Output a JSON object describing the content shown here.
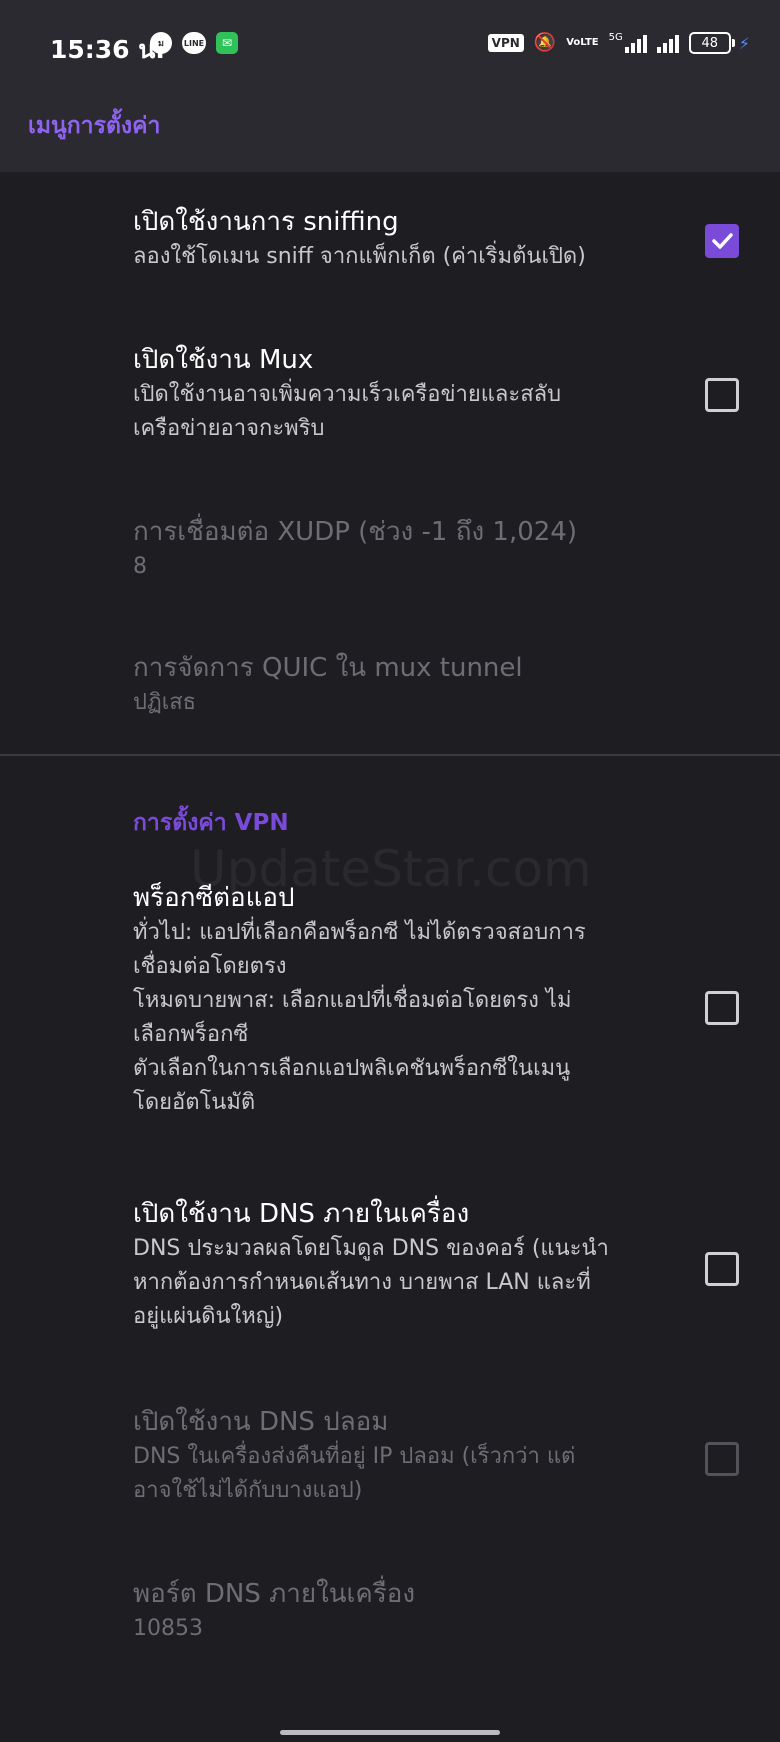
{
  "status_bar": {
    "time": "15:36 น.",
    "notif_icon_1": "ม",
    "notif_icon_2": "LINE",
    "notif_icon_3": "✉",
    "vpn": "VPN",
    "volte": "VoLTE",
    "network": "5G",
    "battery": "48"
  },
  "toolbar": {
    "title": "เมนูการตั้งค่า"
  },
  "prefs": {
    "sniffing": {
      "title": "เปิดใช้งานการ sniffing",
      "summary": "ลองใช้โดเมน sniff จากแพ็กเก็ต (ค่าเริ่มต้นเปิด)",
      "checked": true
    },
    "mux": {
      "title": "เปิดใช้งาน Mux",
      "summary_line1": "เปิดใช้งานอาจเพิ่มความเร็วเครือข่ายและสลับ",
      "summary_line2": "เครือข่ายอาจกะพริบ",
      "checked": false
    },
    "xudp": {
      "title": "การเชื่อมต่อ XUDP (ช่วง -1 ถึง 1,024)",
      "value": "8"
    },
    "quic": {
      "title": "การจัดการ QUIC ใน mux tunnel",
      "value": "ปฏิเสธ"
    }
  },
  "vpn_section": {
    "title": "การตั้งค่า VPN",
    "per_app_proxy": {
      "title": "พร็อกซีต่อแอป",
      "summary_line1": "ทั่วไป: แอปที่เลือกคือพร็อกซี ไม่ได้ตรวจสอบการ",
      "summary_line2": "เชื่อมต่อโดยตรง",
      "summary_line3": "โหมดบายพาส: เลือกแอปที่เชื่อมต่อโดยตรง ไม่",
      "summary_line4": "เลือกพร็อกซี",
      "summary_line5": "ตัวเลือกในการเลือกแอปพลิเคชันพร็อกซีในเมนู",
      "summary_line6": "โดยอัตโนมัติ",
      "checked": false
    },
    "local_dns": {
      "title": "เปิดใช้งาน DNS ภายในเครื่อง",
      "summary_line1": "DNS ประมวลผลโดยโมดูล DNS ของคอร์ (แนะนำ",
      "summary_line2": "หากต้องการกำหนดเส้นทาง บายพาส LAN และที่",
      "summary_line3": "อยู่แผ่นดินใหญ่)",
      "checked": false
    },
    "fake_dns": {
      "title": "เปิดใช้งาน DNS ปลอม",
      "summary_line1": "DNS ในเครื่องส่งคืนที่อยู่ IP ปลอม (เร็วกว่า แต่",
      "summary_line2": "อาจใช้ไม่ได้กับบางแอป)",
      "checked": false
    },
    "local_dns_port": {
      "title": "พอร์ต DNS ภายในเครื่อง",
      "value": "10853"
    }
  },
  "watermark": "UpdateStar.com",
  "colors": {
    "accent": "#7a4ad8",
    "background": "#1e1d22",
    "toolbar": "#2b2a30"
  }
}
